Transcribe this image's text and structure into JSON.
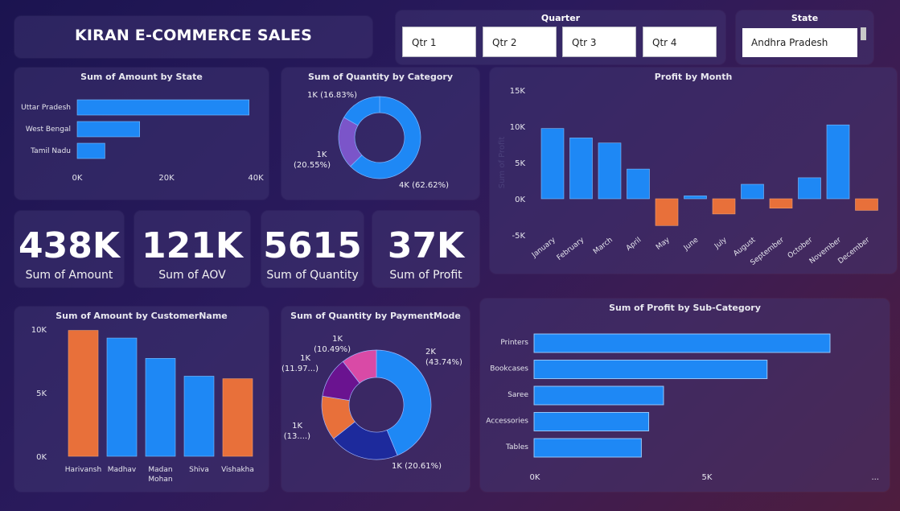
{
  "title": "KIRAN E-COMMERCE SALES",
  "colors": {
    "blue": "#1e88f5",
    "orange": "#e8703a",
    "purple": "#7b55c9",
    "navy": "#1d2a9c",
    "violet": "#6a1390",
    "pink": "#d94aa6",
    "panel": "#3a3270"
  },
  "quarter_slicer": {
    "header": "Quarter",
    "options": [
      "Qtr 1",
      "Qtr 2",
      "Qtr 3",
      "Qtr 4"
    ]
  },
  "state_slicer": {
    "header": "State",
    "selected": "Andhra Pradesh"
  },
  "kpis": [
    {
      "value": "438K",
      "label": "Sum of Amount"
    },
    {
      "value": "121K",
      "label": "Sum of AOV"
    },
    {
      "value": "5615",
      "label": "Sum of Quantity"
    },
    {
      "value": "37K",
      "label": "Sum of Profit"
    }
  ],
  "chart_data": [
    {
      "id": "amount_by_state",
      "type": "bar",
      "orientation": "horizontal",
      "title": "Sum of Amount by State",
      "categories": [
        "Uttar Pradesh",
        "West Bengal",
        "Tamil Nadu"
      ],
      "values": [
        38500,
        14000,
        6200
      ],
      "xlim": [
        0,
        40000
      ],
      "x_ticks": [
        "0K",
        "20K",
        "40K"
      ]
    },
    {
      "id": "quantity_by_category",
      "type": "pie",
      "donut": true,
      "title": "Sum of Quantity by Category",
      "labels": [
        "4K (62.62%)",
        "1K (20.55%)",
        "1K (16.83%)"
      ],
      "values": [
        62.62,
        20.55,
        16.83
      ]
    },
    {
      "id": "profit_by_month",
      "type": "bar",
      "title": "Profit by Month",
      "ylabel": "Sum of Profit",
      "categories": [
        "January",
        "February",
        "March",
        "April",
        "May",
        "June",
        "July",
        "August",
        "September",
        "October",
        "November",
        "December"
      ],
      "values": [
        9700,
        8400,
        7700,
        4100,
        -3700,
        400,
        -2100,
        2000,
        -1300,
        2900,
        10200,
        -1600
      ],
      "ylim": [
        -5000,
        15000
      ],
      "y_ticks": [
        "15K",
        "10K",
        "5K",
        "0K",
        "-5K"
      ]
    },
    {
      "id": "amount_by_customer",
      "type": "bar",
      "title": "Sum of Amount by CustomerName",
      "categories": [
        "Harivansh",
        "Madhav",
        "Madan Mohan",
        "Shiva",
        "Vishakha"
      ],
      "values": [
        9900,
        9300,
        7700,
        6300,
        6100
      ],
      "highlight": [
        true,
        false,
        false,
        false,
        true
      ],
      "ylim": [
        0,
        10000
      ],
      "y_ticks": [
        "10K",
        "5K",
        "0K"
      ]
    },
    {
      "id": "quantity_by_paymentmode",
      "type": "pie",
      "donut": true,
      "title": "Sum of Quantity by PaymentMode",
      "labels": [
        "2K (43.74%)",
        "1K (20.61%)",
        "1K (13....)",
        "1K (11.97...)",
        "1K (10.49%)"
      ],
      "values": [
        43.74,
        20.61,
        13.19,
        11.97,
        10.49
      ]
    },
    {
      "id": "profit_by_subcategory",
      "type": "bar",
      "orientation": "horizontal",
      "title": "Sum of Profit by Sub-Category",
      "categories": [
        "Printers",
        "Bookcases",
        "Saree",
        "Accessories",
        "Tables"
      ],
      "values": [
        8000,
        6300,
        3500,
        3100,
        2900
      ],
      "x_ticks": [
        "0K",
        "5K",
        "..."
      ]
    }
  ]
}
